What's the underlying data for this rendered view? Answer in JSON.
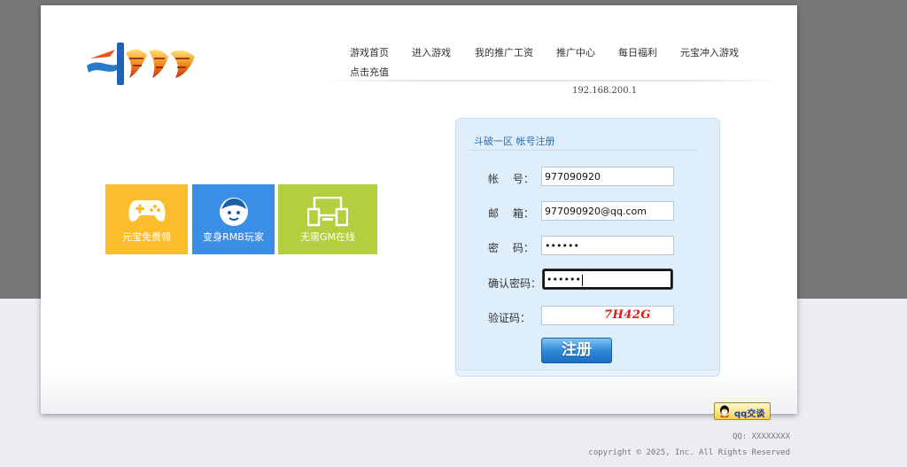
{
  "nav": {
    "items": [
      "游戏首页",
      "进入游戏",
      "我的推广工资",
      "推广中心",
      "每日福利",
      "元宝冲入游戏",
      "点击充值"
    ]
  },
  "server_ip": "192.168.200.1",
  "tiles": [
    {
      "label": "元宝免费领",
      "icon": "gamepad-icon",
      "color": "#fbbd2c"
    },
    {
      "label": "变身RMB玩家",
      "icon": "face-icon",
      "color": "#3a8ee6"
    },
    {
      "label": "无需GM在线",
      "icon": "devices-icon",
      "color": "#b2cf3e"
    }
  ],
  "register": {
    "title": "斗破一区 帐号注册",
    "account_label": "帐　 号：",
    "account_value": "977090920",
    "email_label": "邮　 箱：",
    "email_value": "977090920@qq.com",
    "password_label": "密　 码：",
    "password_value": "••••••",
    "confirm_label": "确认密码：",
    "confirm_value": "••••••",
    "captcha_label": "验证码：",
    "captcha_text": "7H42G",
    "submit_label": "注册"
  },
  "qq_button_label": "qq交谈",
  "footer": {
    "qq": "QQ: XXXXXXXX",
    "copyright": "copyright © 2025, Inc. All Rights Reserved"
  },
  "colors": {
    "accent": "#2a6fb1",
    "captcha": "#e01818"
  }
}
